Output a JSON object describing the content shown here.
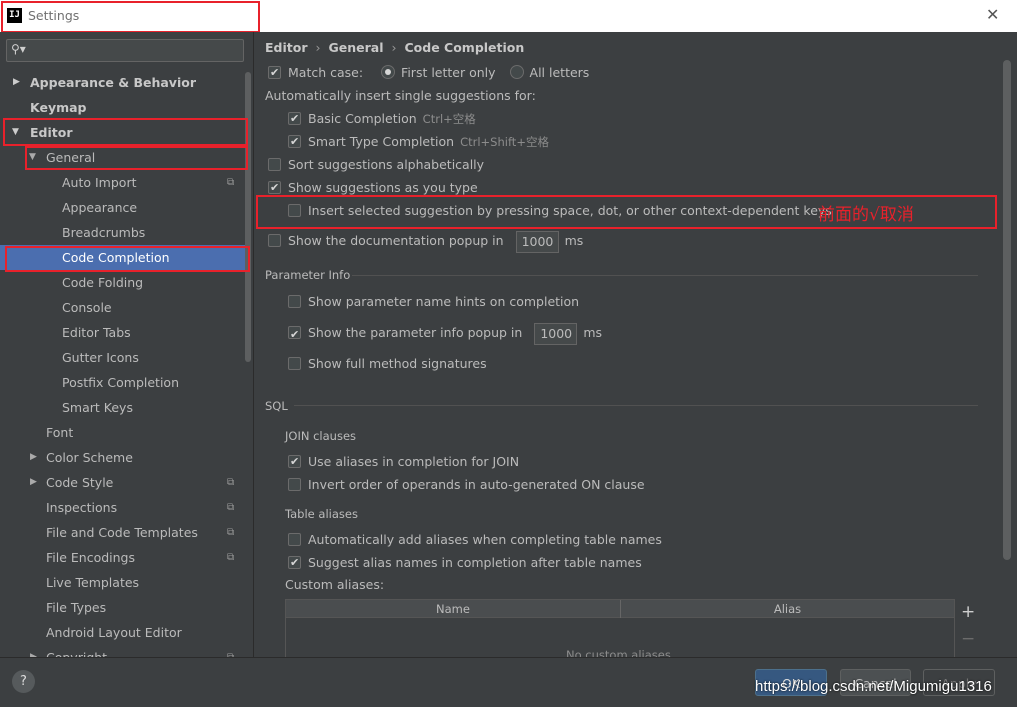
{
  "window": {
    "title": "Settings",
    "app_icon": "IJ"
  },
  "search": {
    "placeholder": ""
  },
  "sidebar": {
    "items": [
      {
        "label": "Appearance & Behavior"
      },
      {
        "label": "Keymap"
      },
      {
        "label": "Editor"
      },
      {
        "label": "General"
      },
      {
        "label": "Auto Import"
      },
      {
        "label": "Appearance"
      },
      {
        "label": "Breadcrumbs"
      },
      {
        "label": "Code Completion"
      },
      {
        "label": "Code Folding"
      },
      {
        "label": "Console"
      },
      {
        "label": "Editor Tabs"
      },
      {
        "label": "Gutter Icons"
      },
      {
        "label": "Postfix Completion"
      },
      {
        "label": "Smart Keys"
      },
      {
        "label": "Font"
      },
      {
        "label": "Color Scheme"
      },
      {
        "label": "Code Style"
      },
      {
        "label": "Inspections"
      },
      {
        "label": "File and Code Templates"
      },
      {
        "label": "File Encodings"
      },
      {
        "label": "Live Templates"
      },
      {
        "label": "File Types"
      },
      {
        "label": "Android Layout Editor"
      },
      {
        "label": "Copyright"
      }
    ]
  },
  "breadcrumb": {
    "root": "Editor",
    "mid": "General",
    "leaf": "Code Completion",
    "separator": "›"
  },
  "completion": {
    "match_case": "Match case:",
    "first_letter": "First letter only",
    "all_letters": "All letters",
    "auto_insert": "Automatically insert single suggestions for:",
    "basic": "Basic Completion",
    "basic_key": "Ctrl+空格",
    "smart": "Smart Type Completion",
    "smart_key": "Ctrl+Shift+空格",
    "sort_alpha": "Sort suggestions alphabetically",
    "show_as_type": "Show suggestions as you type",
    "insert_selected": "Insert selected suggestion by pressing space, dot, or other context-dependent keys",
    "doc_popup": "Show the documentation popup in",
    "doc_popup_value": "1000",
    "ms": "ms"
  },
  "annotation": "前面的√取消",
  "param_info": {
    "title": "Parameter Info",
    "name_hints": "Show parameter name hints on completion",
    "info_popup": "Show the parameter info popup in",
    "info_popup_value": "1000",
    "ms": "ms",
    "full_sigs": "Show full method signatures"
  },
  "sql": {
    "title": "SQL",
    "join_clauses": "JOIN clauses",
    "use_aliases": "Use aliases in completion for JOIN",
    "invert_order": "Invert order of operands in auto-generated ON clause",
    "table_aliases": "Table aliases",
    "auto_add": "Automatically add aliases when completing table names",
    "suggest_alias": "Suggest alias names in completion after table names",
    "custom_aliases": "Custom aliases:",
    "col_name": "Name",
    "col_alias": "Alias",
    "empty": "No custom aliases",
    "plus": "+",
    "minus": "−"
  },
  "buttons": {
    "help": "?",
    "ok": "OK",
    "cancel": "Cancel",
    "apply": "Apply"
  },
  "watermark": "https://blog.csdn.net/Migumigu1316",
  "colors": {
    "highlight": "#e8212b",
    "selection": "#4b6eaf",
    "background": "#3c3f41"
  }
}
